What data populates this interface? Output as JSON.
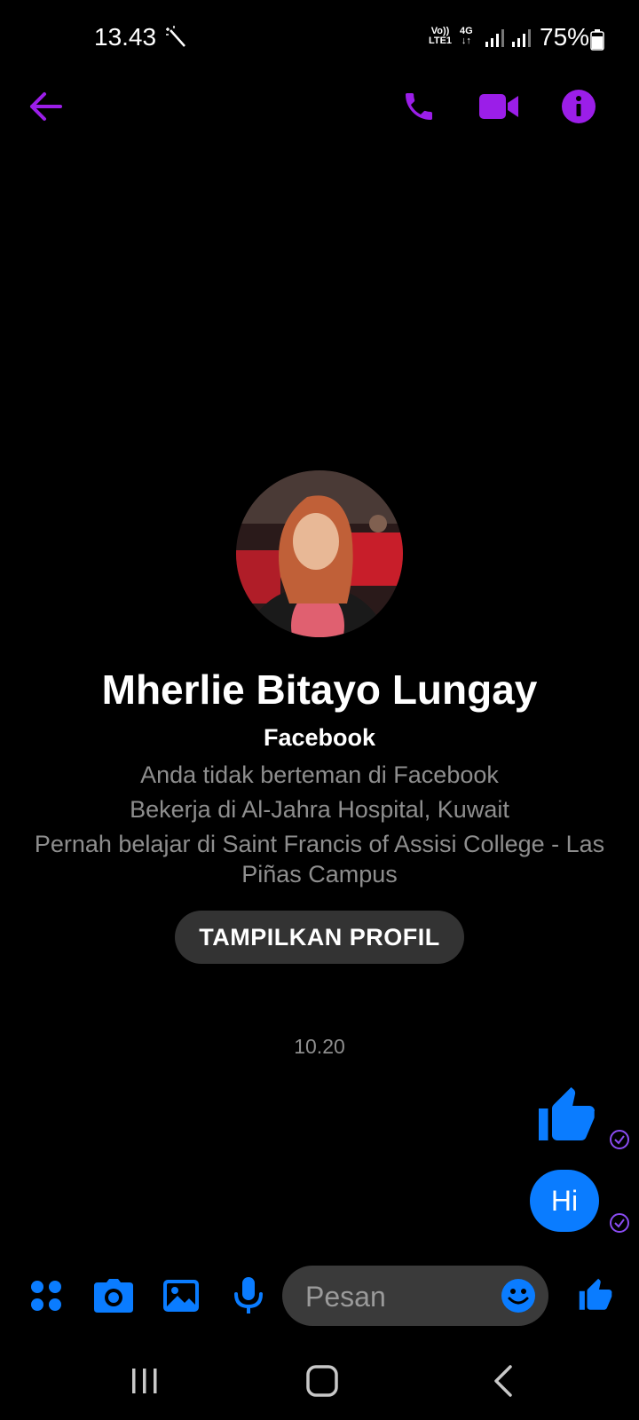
{
  "status_bar": {
    "time": "13.43",
    "network_lte": "Vo)) LTE1",
    "network_4g": "4G",
    "battery_percent": "75%",
    "battery_level": 0.75
  },
  "header": {
    "icons": [
      "back-arrow-icon",
      "phone-icon",
      "video-camera-icon",
      "info-icon"
    ],
    "accent_color": "#9b1ee8"
  },
  "profile": {
    "name": "Mherlie Bitayo Lungay",
    "source": "Facebook",
    "friend_status": "Anda tidak berteman di Facebook",
    "work": "Bekerja di Al-Jahra Hospital, Kuwait",
    "education": "Pernah belajar di Saint Francis of Assisi College - Las Piñas Campus",
    "view_profile_label": "TAMPILKAN PROFIL"
  },
  "conversation": {
    "timestamp": "10.20",
    "messages": [
      {
        "type": "like",
        "icon": "thumbs-up-icon"
      },
      {
        "type": "text",
        "text": "Hi"
      }
    ]
  },
  "composer": {
    "placeholder": "Pesan",
    "icons": [
      "apps-grid-icon",
      "camera-icon",
      "gallery-icon",
      "microphone-icon",
      "emoji-icon",
      "thumbs-up-icon"
    ],
    "accent_color": "#0a7cff"
  },
  "nav_bar": {
    "icons": [
      "recent-apps-icon",
      "home-icon",
      "back-icon"
    ]
  }
}
